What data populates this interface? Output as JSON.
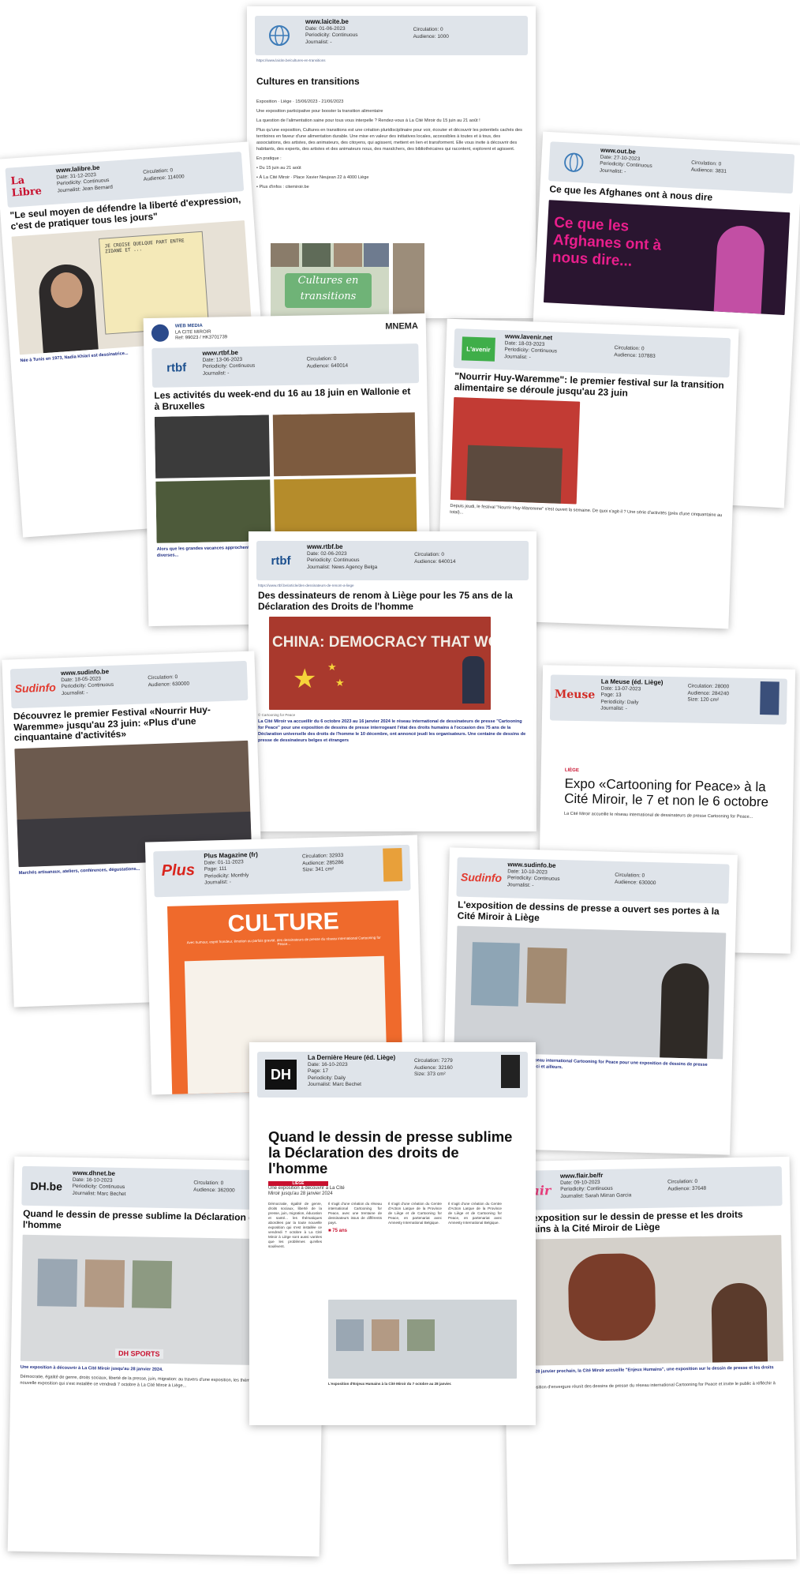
{
  "card1": {
    "site": "www.laicite.be",
    "date": "Date: 01-06-2023",
    "periodicity": "Periodicity: Continuous",
    "journalist": "Journalist: -",
    "circulation": "Circulation: 0",
    "audience": "Audience: 1000",
    "title": "Cultures en transitions",
    "body": [
      "Exposition · Liège · 15/06/2023 - 21/06/2023",
      "Une exposition participative pour booster la transition alimentaire",
      "La question de l'alimentation saine pour tous vous interpelle ? Rendez-vous à La Cité Miroir du 15 juin au 21 août !",
      "Plus qu'une exposition, Cultures en transitions est une création pluridisciplinaire pour voir, écouter et découvrir les potentiels cachés des territoires en faveur d'une alimentation durable. Une mise en valeur des initiatives locales, accessibles à toutes et à tous, des associations, des artistes, des animateurs, des citoyens, qui agissent, mettent en lien et transforment. Elle vous invite à découvrir des habitants, des experts, des artistes et des animateurs nous, des maraîchers, des bibliothécaires qui racontent, explorent et agissent.",
      "En pratique :",
      "• Du 15 juin au 21 août",
      "• À La Cité Miroir · Place Xavier Neujean 22 à 4000 Liège",
      "• Plus d'infos : citemiroir.be"
    ],
    "poster": "Cultures en transitions"
  },
  "card2": {
    "site": "www.lalibre.be",
    "logo": "La Libre",
    "date": "Date: 31-12-2023",
    "periodicity": "Periodicity: Continuous",
    "journalist": "Journalist: Jean Bernard",
    "circulation": "Circulation: 0",
    "audience": "Audience: 114000",
    "title": "\"Le seul moyen de défendre la liberté d'expression, c'est de pratiquer tous les jours\"",
    "cartoon_text": "JE CROISE QUELQUE PART ENTRE ZIDANE ET ...",
    "body": "Née à Tunis en 1973, Nadia Khiari est dessinatrice..."
  },
  "card3": {
    "site": "www.out.be",
    "date": "Date: 27-10-2023",
    "periodicity": "Periodicity: Continuous",
    "journalist": "Journalist: -",
    "circulation": "Circulation: 0",
    "audience": "Audience: 3831",
    "title": "Ce que les Afghanes ont à nous dire",
    "poster_text": "Ce que les Afghanes ont à nous dire..."
  },
  "card4": {
    "agency": "WEB MEDIA",
    "client": "LA CITE MIROIR",
    "ref": "Ref: 99023 / HK3701739",
    "brand": "MNEMA",
    "site": "www.rtbf.be",
    "logo": "rtbf",
    "date": "Date: 13-06-2023",
    "periodicity": "Periodicity: Continuous",
    "journalist": "Journalist: -",
    "circulation": "Circulation: 0",
    "audience": "Audience: 640014",
    "title": "Les activités du week-end du 16 au 18 juin en Wallonie et à Bruxelles",
    "body": "Alors que les grandes vacances approchent, et que la Fête de la Musique, le week-end s'annonce riche en activités diverses..."
  },
  "card5": {
    "site": "www.lavenir.net",
    "logo": "L'avenir",
    "date": "Date: 18-03-2023",
    "periodicity": "Periodicity: Continuous",
    "journalist": "Journalist: -",
    "circulation": "Circulation: 0",
    "audience": "Audience: 107883",
    "title": "\"Nourrir Huy-Waremme\": le premier festival sur la transition alimentaire se déroule jusqu'au 23 juin",
    "body": "Depuis jeudi, le festival \"Nourrir Huy-Waremme\" s'est ouvert la semaine. De quoi s'agit-il ? Une série d'activités (près d'une cinquantaine au total)..."
  },
  "card6": {
    "site": "www.rtbf.be",
    "logo": "rtbf",
    "date": "Date: 02-06-2023",
    "periodicity": "Periodicity: Continuous",
    "journalist": "Journalist: News Agency Belga",
    "circulation": "Circulation: 0",
    "audience": "Audience: 640014",
    "title": "Des dessinateurs de renom à Liège pour les 75 ans de la Déclaration des Droits de l'homme",
    "wall_text": "CHINA: DEMOCRACY THAT WORKS",
    "caption": "© Cartooning for Peace",
    "body": "La Cité Miroir va accueillir du 6 octobre 2023 au 16 janvier 2024 le réseau international de dessinateurs de presse \"Cartooning for Peace\" pour une exposition de dessins de presse interrogeant l'état des droits humains à l'occasion des 75 ans de la Déclaration universelle des droits de l'homme le 10 décembre, ont annoncé jeudi les organisateurs. Une centaine de dessins de presse de dessinateurs belges et étrangers"
  },
  "card7": {
    "site": "www.sudinfo.be",
    "logo": "Sudinfo",
    "date": "Date: 18-05-2023",
    "periodicity": "Periodicity: Continuous",
    "journalist": "Journalist: -",
    "circulation": "Circulation: 0",
    "audience": "Audience: 630000",
    "title": "Découvrez le premier Festival «Nourrir Huy-Waremme» jusqu'au 23 juin: «Plus d'une cinquantaine d'activités»",
    "body": "Marchés artisanaux, ateliers, conférences, dégustations..."
  },
  "card8": {
    "site": "La Meuse (éd. Liège)",
    "logo": "Meuse",
    "date": "Date: 13-07-2023",
    "page": "Page: 13",
    "periodicity": "Periodicity: Daily",
    "journalist": "Journalist: -",
    "circulation": "Circulation: 28000",
    "audience": "Audience: 284240",
    "size": "Size: 120 cm²",
    "kicker": "LIÈGE",
    "title": "Expo «Cartooning for Peace» à la Cité Miroir, le 7 et non le 6 octobre",
    "body": "La Cité Miroir accueille le réseau international de dessinateurs de presse Cartooning for Peace..."
  },
  "card9": {
    "site": "Plus Magazine (fr)",
    "logo": "Plus",
    "date": "Date: 01-11-2023",
    "page": "Page: 111",
    "periodicity": "Periodicity: Monthly",
    "journalist": "Journalist: -",
    "circulation": "Circulation: 32933",
    "audience": "Audience: 285286",
    "size": "Size: 341 cm²",
    "banner": "CULTURE",
    "body": "Avec humour, esprit frondeur, émotion ou parfois gravité, des dessinateurs de presse du réseau international Cartooning for Peace..."
  },
  "card10": {
    "site": "www.sudinfo.be",
    "logo": "Sudinfo",
    "date": "Date: 10-10-2023",
    "periodicity": "Periodicity: Continuous",
    "journalist": "Journalist: -",
    "circulation": "Circulation: 0",
    "audience": "Audience: 630000",
    "title": "L'exposition de dessins de presse a ouvert ses portes à la Cité Miroir à Liège",
    "body": "... à Liège, La Cité Miroir accueille le réseau international Cartooning for Peace pour une exposition de dessins de presse interrogeant l'état des droits humains, ici et ailleurs."
  },
  "card11": {
    "site": "www.dhnet.be",
    "logo": "DH.be",
    "date": "Date: 16-10-2023",
    "periodicity": "Periodicity: Continuous",
    "journalist": "Journalist: Marc Bechet",
    "circulation": "Circulation: 0",
    "audience": "Audience: 362000",
    "title": "Quand le dessin de presse sublime la Déclaration des droits de l'homme",
    "sports": "DH SPORTS",
    "body": "Une exposition à découvrir à La Cité Miroir jusqu'au 28 janvier 2024.",
    "body2": "Démocratie, égalité de genre, droits sociaux, liberté de la presse, juin, migration: au travers d'une exposition, les thématiques abordées par la toute nouvelle exposition qui s'est installée ce vendredi 7 octobre à La Cité Miroir à Liège..."
  },
  "card12": {
    "site": "La Dernière Heure (éd. Liège)",
    "logo": "DH",
    "date": "Date: 16-10-2023",
    "page": "Page: 17",
    "periodicity": "Periodicity: Daily",
    "journalist": "Journalist: Marc Bechet",
    "circulation": "Circulation: 7279",
    "audience": "Audience: 32160",
    "size": "Size: 373 cm²",
    "title": "Quand le dessin de presse sublime la Déclaration des droits de l'homme",
    "kicker": "LIÈGE",
    "standfirst": "Une exposition à découvrir à La Cité Miroir jusqu'au 28 janvier 2024",
    "col1": "Démocratie, égalité de genre, droits sociaux, liberté de la presse, juin, migration, éducation et santé... les thématiques abordées par la toute nouvelle exposition qui s'est installée ce vendredi 7 octobre à La Cité Miroir à Liège sont aussi variées que les problèmes qu'elles soulèvent.",
    "col2": "Il s'agit d'une création du réseau international Cartooning for Peace, avec une trentaine de dessinateurs issus de différents pays.",
    "col3": "Il s'agit d'une création du Centre d'Action Laïque de la Province de Liège et de Cartooning for Peace, en partenariat avec Amnesty International Belgique.",
    "years": "75 ans",
    "photo_caption": "L'exposition d'Enjeux Humains à la Cité Miroir du 7 octobre au 28 janvier."
  },
  "card13": {
    "site": "www.flair.be/fr",
    "logo": "Flair",
    "date": "Date: 09-10-2023",
    "periodicity": "Periodicity: Continuous",
    "journalist": "Journalist: Sarah Mirran Garcia",
    "circulation": "Circulation: 0",
    "audience": "Audience: 37648",
    "title": "Une exposition sur le dessin de presse et les droits humains à la Cité Miroir de Liège",
    "body": "Jusqu'au 28 janvier prochain, la Cité Miroir accueille \"Enjeux Humains\", une exposition sur le dessin de presse et les droits humains.",
    "body2": "Cette exposition d'envergure réunit des dessins de presse du réseau international Cartooning for Peace et invite le public à réfléchir à l'actualité."
  }
}
